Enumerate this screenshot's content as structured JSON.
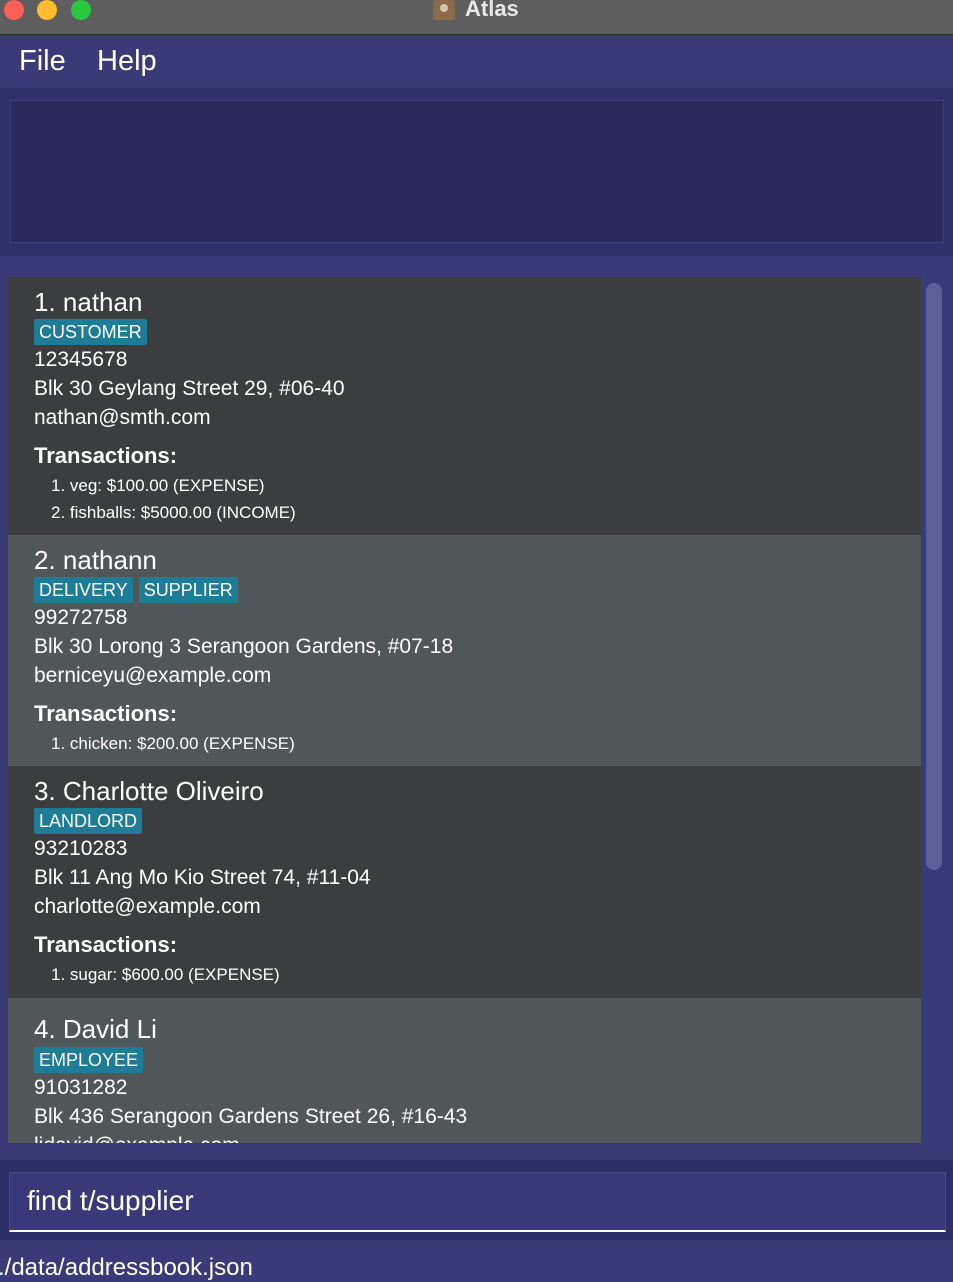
{
  "window": {
    "title": "Atlas",
    "app_icon": "contacts-book-icon"
  },
  "menu": {
    "file": "File",
    "help": "Help"
  },
  "result_display": {
    "text": ""
  },
  "persons": [
    {
      "index_name": "1. nathan",
      "tags": [
        "CUSTOMER"
      ],
      "phone": "12345678",
      "address": "Blk 30 Geylang Street 29, #06-40",
      "email": "nathan@smth.com",
      "transactions_label": "Transactions:",
      "transactions": [
        "1. veg: $100.00 (EXPENSE)",
        "2. fishballs: $5000.00 (INCOME)"
      ]
    },
    {
      "index_name": "2. nathann",
      "tags": [
        "DELIVERY",
        "SUPPLIER"
      ],
      "phone": "99272758",
      "address": "Blk 30 Lorong 3 Serangoon Gardens, #07-18",
      "email": "berniceyu@example.com",
      "transactions_label": "Transactions:",
      "transactions": [
        "1. chicken: $200.00 (EXPENSE)"
      ]
    },
    {
      "index_name": "3. Charlotte Oliveiro",
      "tags": [
        "LANDLORD"
      ],
      "phone": "93210283",
      "address": "Blk 11 Ang Mo Kio Street 74, #11-04",
      "email": "charlotte@example.com",
      "transactions_label": "Transactions:",
      "transactions": [
        "1. sugar: $600.00 (EXPENSE)"
      ]
    },
    {
      "index_name": "4. David Li",
      "tags": [
        "EMPLOYEE"
      ],
      "phone": "91031282",
      "address": "Blk 436 Serangoon Gardens Street 26, #16-43",
      "email": "lidavid@example.com"
    }
  ],
  "command": {
    "value": "find t/supplier"
  },
  "status": {
    "path": "./data/addressbook.json"
  },
  "colors": {
    "background": "#3a3a78",
    "card_dark": "#3c3d3f",
    "card_light": "#515658",
    "tag": "#1f7c96"
  }
}
